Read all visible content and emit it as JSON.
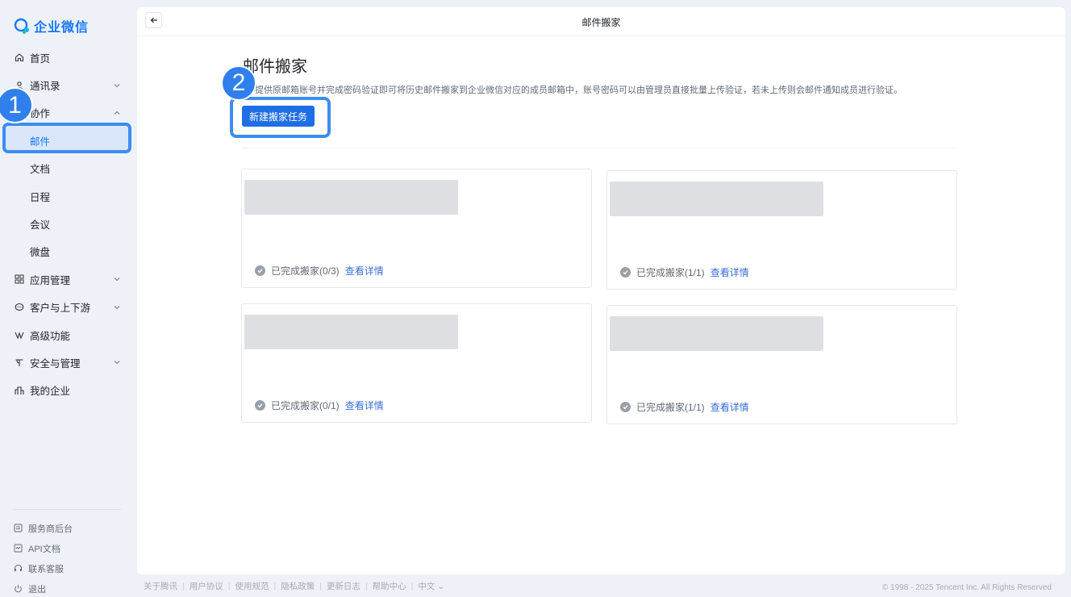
{
  "brand": {
    "name": "企业微信"
  },
  "nav": {
    "items": [
      {
        "label": "首页",
        "icon": "home-icon"
      },
      {
        "label": "通讯录",
        "icon": "contacts-icon",
        "expandable": true
      },
      {
        "label": "协作",
        "icon": "collab-icon",
        "expandable": true,
        "expanded": true
      },
      {
        "label": "邮件",
        "sub": true,
        "active": true
      },
      {
        "label": "文档",
        "sub": true
      },
      {
        "label": "日程",
        "sub": true
      },
      {
        "label": "会议",
        "sub": true
      },
      {
        "label": "微盘",
        "sub": true
      },
      {
        "label": "应用管理",
        "icon": "grid-icon",
        "expandable": true
      },
      {
        "label": "客户与上下游",
        "icon": "chat-icon",
        "expandable": true
      },
      {
        "label": "高级功能",
        "icon": "diamond-icon"
      },
      {
        "label": "安全与管理",
        "icon": "security-icon",
        "expandable": true
      },
      {
        "label": "我的企业",
        "icon": "building-icon"
      }
    ],
    "footer": [
      {
        "label": "服务商后台",
        "icon": "console-icon"
      },
      {
        "label": "API文档",
        "icon": "api-icon"
      },
      {
        "label": "联系客服",
        "icon": "headset-icon"
      },
      {
        "label": "退出",
        "icon": "power-icon"
      }
    ]
  },
  "topbar": {
    "title": "邮件搬家"
  },
  "page": {
    "title": "邮件搬家",
    "description": "提供原邮箱账号并完成密码验证即可将历史邮件搬家到企业微信对应的成员邮箱中，账号密码可以由管理员直接批量上传验证，若未上传则会邮件通知成员进行验证。",
    "new_task_label": "新建搬家任务"
  },
  "tasks": [
    {
      "status": "已完成搬家(0/3)",
      "detail": "查看详情"
    },
    {
      "status": "已完成搬家(1/1)",
      "detail": "查看详情"
    },
    {
      "status": "已完成搬家(0/1)",
      "detail": "查看详情"
    },
    {
      "status": "已完成搬家(1/1)",
      "detail": "查看详情"
    }
  ],
  "steps": [
    "1",
    "2"
  ],
  "footer": {
    "links": [
      "关于腾讯",
      "用户协议",
      "使用规范",
      "隐私政策",
      "更新日志",
      "帮助中心",
      "中文"
    ],
    "copyright": "© 1998 - 2025 Tencent Inc. All Rights Reserved"
  },
  "colors": {
    "accent": "#1f6ee6",
    "highlight": "#3d8cf0",
    "link": "#3a6fd8"
  }
}
